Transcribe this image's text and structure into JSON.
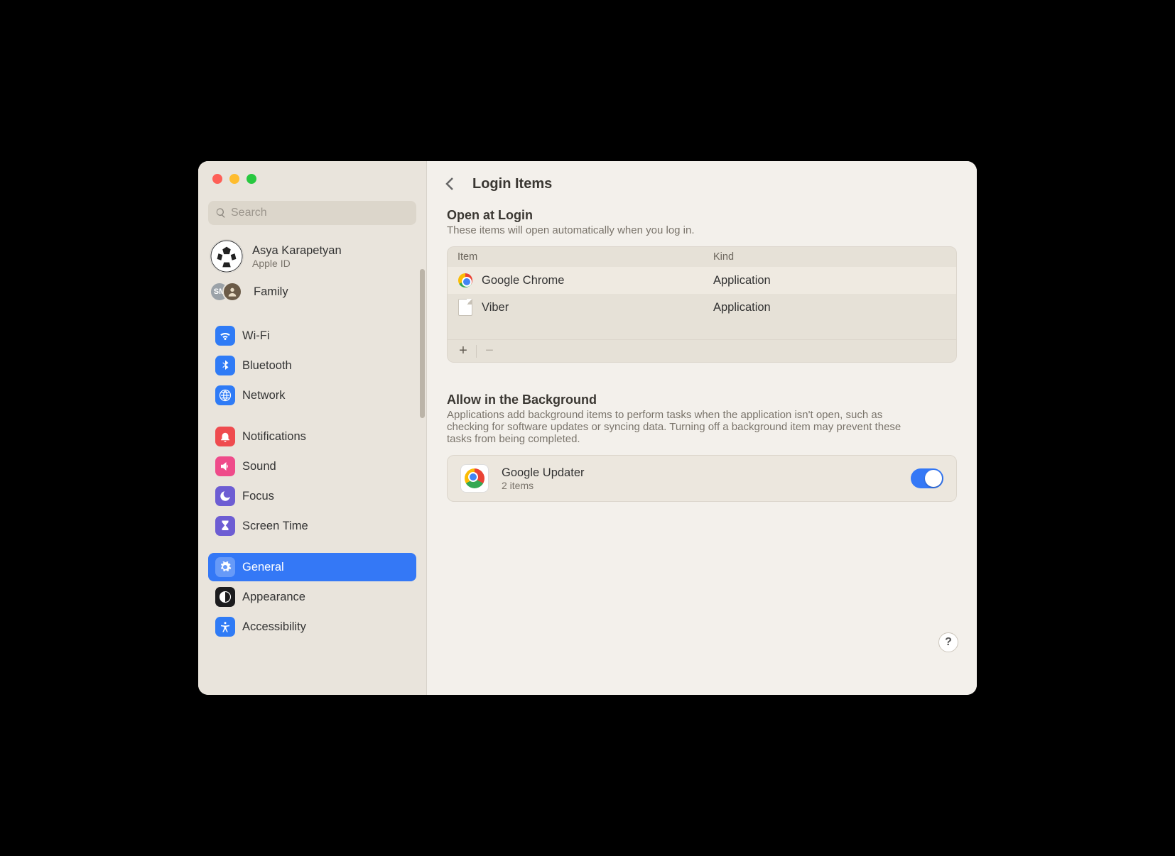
{
  "search": {
    "placeholder": "Search"
  },
  "account": {
    "name": "Asya Karapetyan",
    "sub": "Apple ID"
  },
  "family": {
    "label": "Family",
    "badge": "SM"
  },
  "sidebar": {
    "items": [
      {
        "label": "Wi-Fi",
        "icon": "wifi",
        "selected": false
      },
      {
        "label": "Bluetooth",
        "icon": "bt",
        "selected": false
      },
      {
        "label": "Network",
        "icon": "net",
        "selected": false
      }
    ],
    "items2": [
      {
        "label": "Notifications",
        "icon": "notif",
        "selected": false
      },
      {
        "label": "Sound",
        "icon": "sound",
        "selected": false
      },
      {
        "label": "Focus",
        "icon": "focus",
        "selected": false
      },
      {
        "label": "Screen Time",
        "icon": "screen",
        "selected": false
      }
    ],
    "items3": [
      {
        "label": "General",
        "icon": "general",
        "selected": true
      },
      {
        "label": "Appearance",
        "icon": "appear",
        "selected": false
      },
      {
        "label": "Accessibility",
        "icon": "access",
        "selected": false
      }
    ]
  },
  "page": {
    "title": "Login Items",
    "openAtLogin": {
      "title": "Open at Login",
      "sub": "These items will open automatically when you log in.",
      "columns": {
        "item": "Item",
        "kind": "Kind"
      },
      "rows": [
        {
          "name": "Google Chrome",
          "kind": "Application",
          "icon": "chrome"
        },
        {
          "name": "Viber",
          "kind": "Application",
          "icon": "doc"
        }
      ],
      "addSymbol": "+",
      "removeSymbol": "−"
    },
    "background": {
      "title": "Allow in the Background",
      "sub": "Applications add background items to perform tasks when the application isn't open, such as checking for software updates or syncing data. Turning off a background item may prevent these tasks from being completed.",
      "items": [
        {
          "name": "Google Updater",
          "sub": "2 items",
          "enabled": true,
          "icon": "chrome"
        }
      ]
    },
    "help": "?"
  }
}
